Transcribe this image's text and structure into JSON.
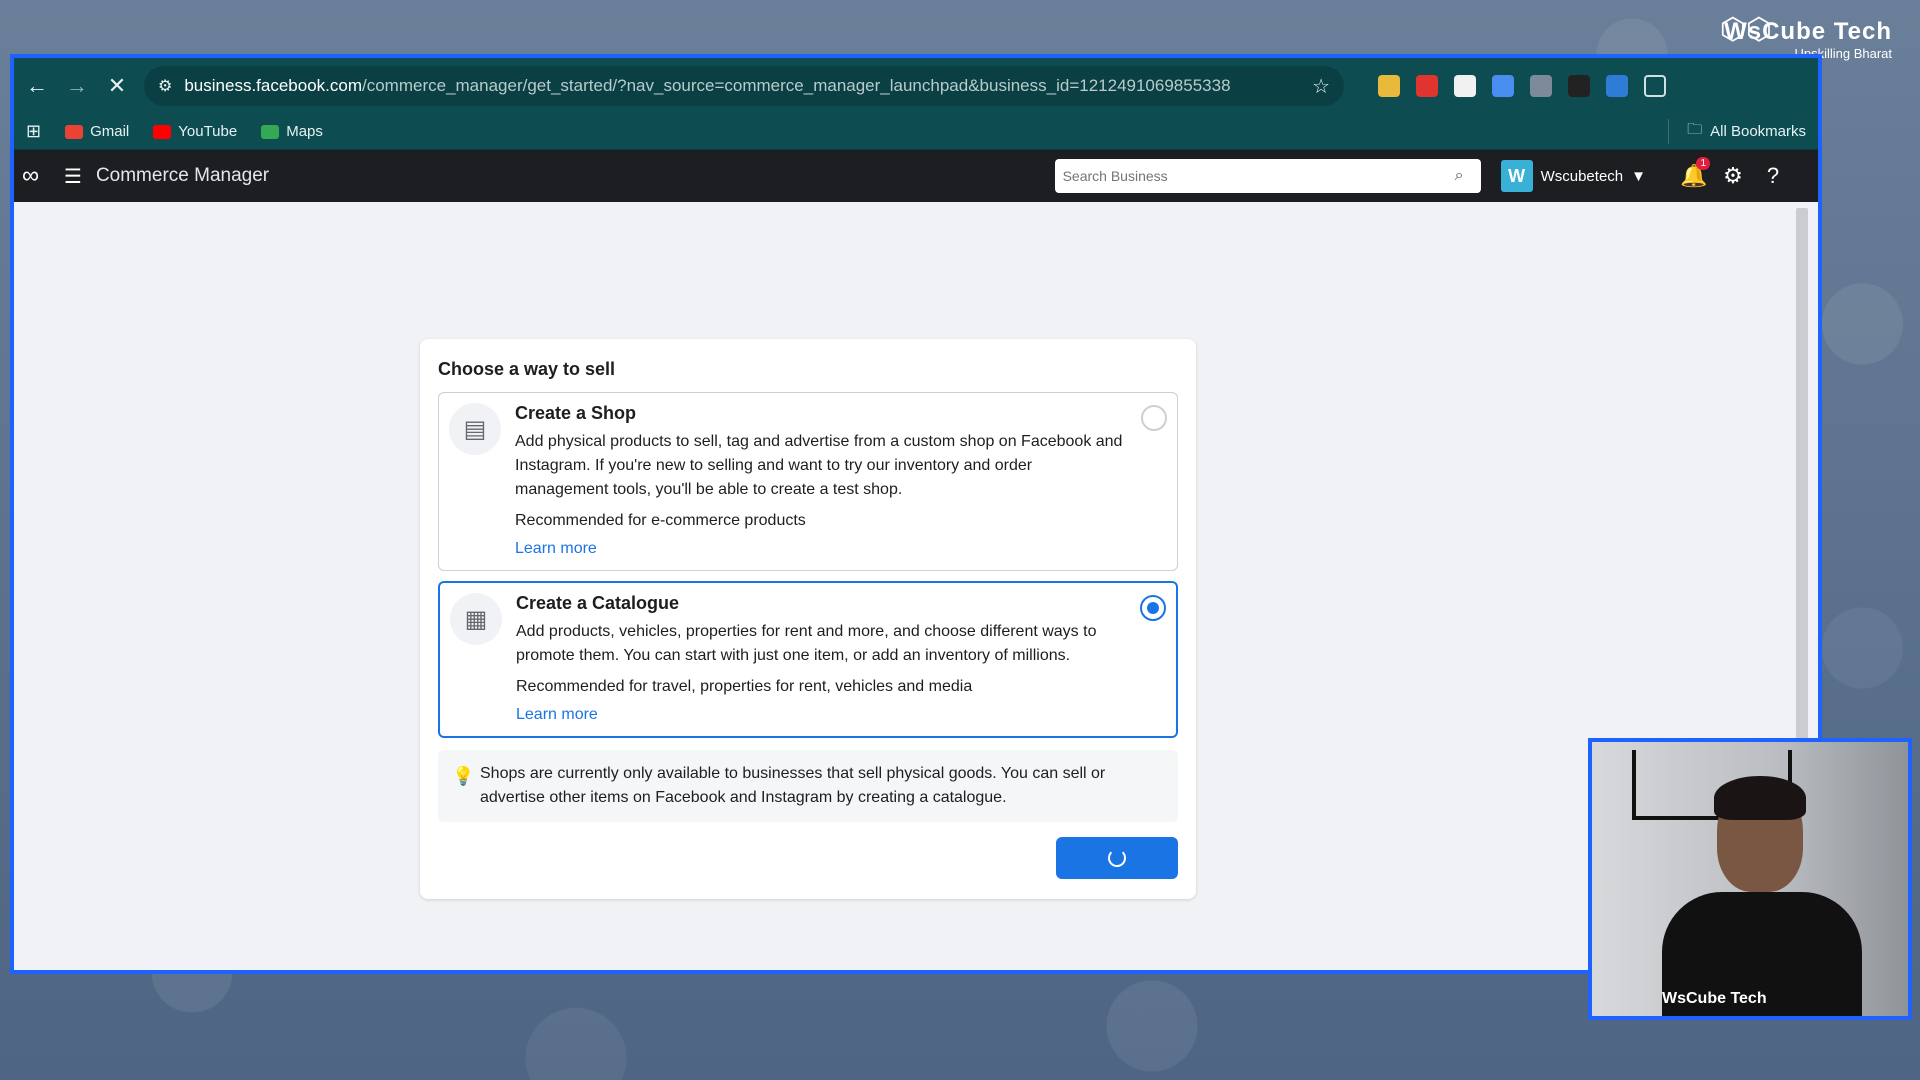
{
  "browser": {
    "url_host": "business.facebook.com",
    "url_path": "/commerce_manager/get_started/?nav_source=commerce_manager_launchpad&business_id=1212491069855338",
    "bookmarks": [
      {
        "label": "Gmail",
        "color": "#ea4335"
      },
      {
        "label": "YouTube",
        "color": "#ff0000"
      },
      {
        "label": "Maps",
        "color": "#34a853"
      }
    ],
    "all_bookmarks": "All Bookmarks"
  },
  "header": {
    "title": "Commerce Manager",
    "search_placeholder": "Search Business",
    "business_initial": "W",
    "business_name": "Wscubetech",
    "notification_count": "1"
  },
  "card": {
    "title": "Choose a way to sell",
    "options": [
      {
        "title": "Create a Shop",
        "description": "Add physical products to sell, tag and advertise from a custom shop on Facebook and Instagram. If you're new to selling and want to try our inventory and order management tools, you'll be able to create a test shop.",
        "recommended": "Recommended for e-commerce products",
        "link": "Learn more",
        "selected": false
      },
      {
        "title": "Create a Catalogue",
        "description": "Add products, vehicles, properties for rent and more, and choose different ways to promote them. You can start with just one item, or add an inventory of millions.",
        "recommended": "Recommended for travel, properties for rent, vehicles and media",
        "link": "Learn more",
        "selected": true
      }
    ],
    "info": "Shops are currently only available to businesses that sell physical goods. You can sell or advertise other items on Facebook and Instagram by creating a catalogue."
  },
  "branding": {
    "name": "WsCube Tech",
    "tagline": "Upskilling Bharat",
    "shirt_logo": "WsCube Tech"
  },
  "colors": {
    "accent": "#1b74e4",
    "browser_frame": "#0d4d52",
    "header_bg": "#1c1e21"
  }
}
